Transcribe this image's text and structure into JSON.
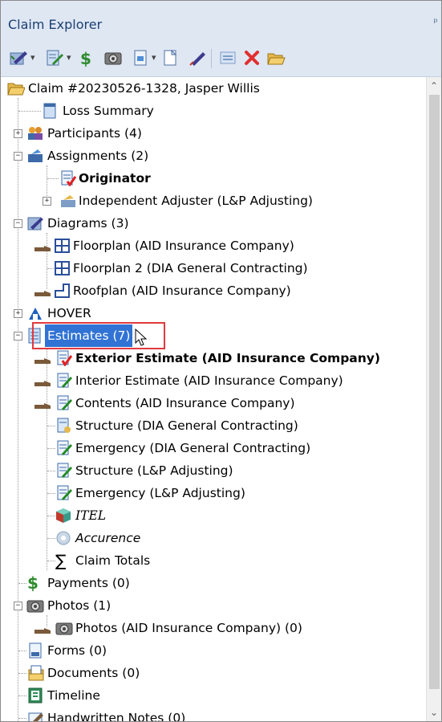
{
  "panel": {
    "title": "Claim Explorer",
    "pin": "ᵖ"
  },
  "colors": {
    "selection": "#3073d4",
    "highlight_box": "#e0393e",
    "header_bg": "#dfe7f3"
  },
  "toolbar": {
    "items": [
      "edit-icon",
      "edit-doc-icon",
      "payment-icon",
      "photo-icon",
      "new-doc-icon",
      "blank-doc-icon",
      "pen-icon",
      "export-icon",
      "delete-icon",
      "open-folder-icon"
    ]
  },
  "tree": {
    "root": "Claim #20230526-1328, Jasper Willis",
    "loss_summary": "Loss Summary",
    "participants": "Participants (4)",
    "assignments": "Assignments (2)",
    "originator": "Originator",
    "independent_adjuster": "Independent Adjuster (L&P Adjusting)",
    "diagrams": "Diagrams (3)",
    "floorplan": "Floorplan (AID Insurance Company)",
    "floorplan2": "Floorplan 2 (DIA General Contracting)",
    "roofplan": "Roofplan (AID Insurance Company)",
    "hover": "HOVER",
    "estimates": "Estimates (7)",
    "exterior_estimate": "Exterior Estimate (AID Insurance Company)",
    "interior_estimate": "Interior Estimate (AID Insurance Company)",
    "contents": "Contents (AID Insurance Company)",
    "structure_dia": "Structure (DIA General Contracting)",
    "emergency_dia": "Emergency (DIA General Contracting)",
    "structure_lp": "Structure (L&P Adjusting)",
    "emergency_lp": "Emergency (L&P Adjusting)",
    "itel": "ITEL",
    "accurence": "Accurence",
    "claim_totals": "Claim Totals",
    "payments": "Payments (0)",
    "photos": "Photos (1)",
    "photos_company": "Photos (AID Insurance Company) (0)",
    "forms": "Forms (0)",
    "documents": "Documents (0)",
    "timeline": "Timeline",
    "handwritten_notes": "Handwritten Notes (0)"
  }
}
